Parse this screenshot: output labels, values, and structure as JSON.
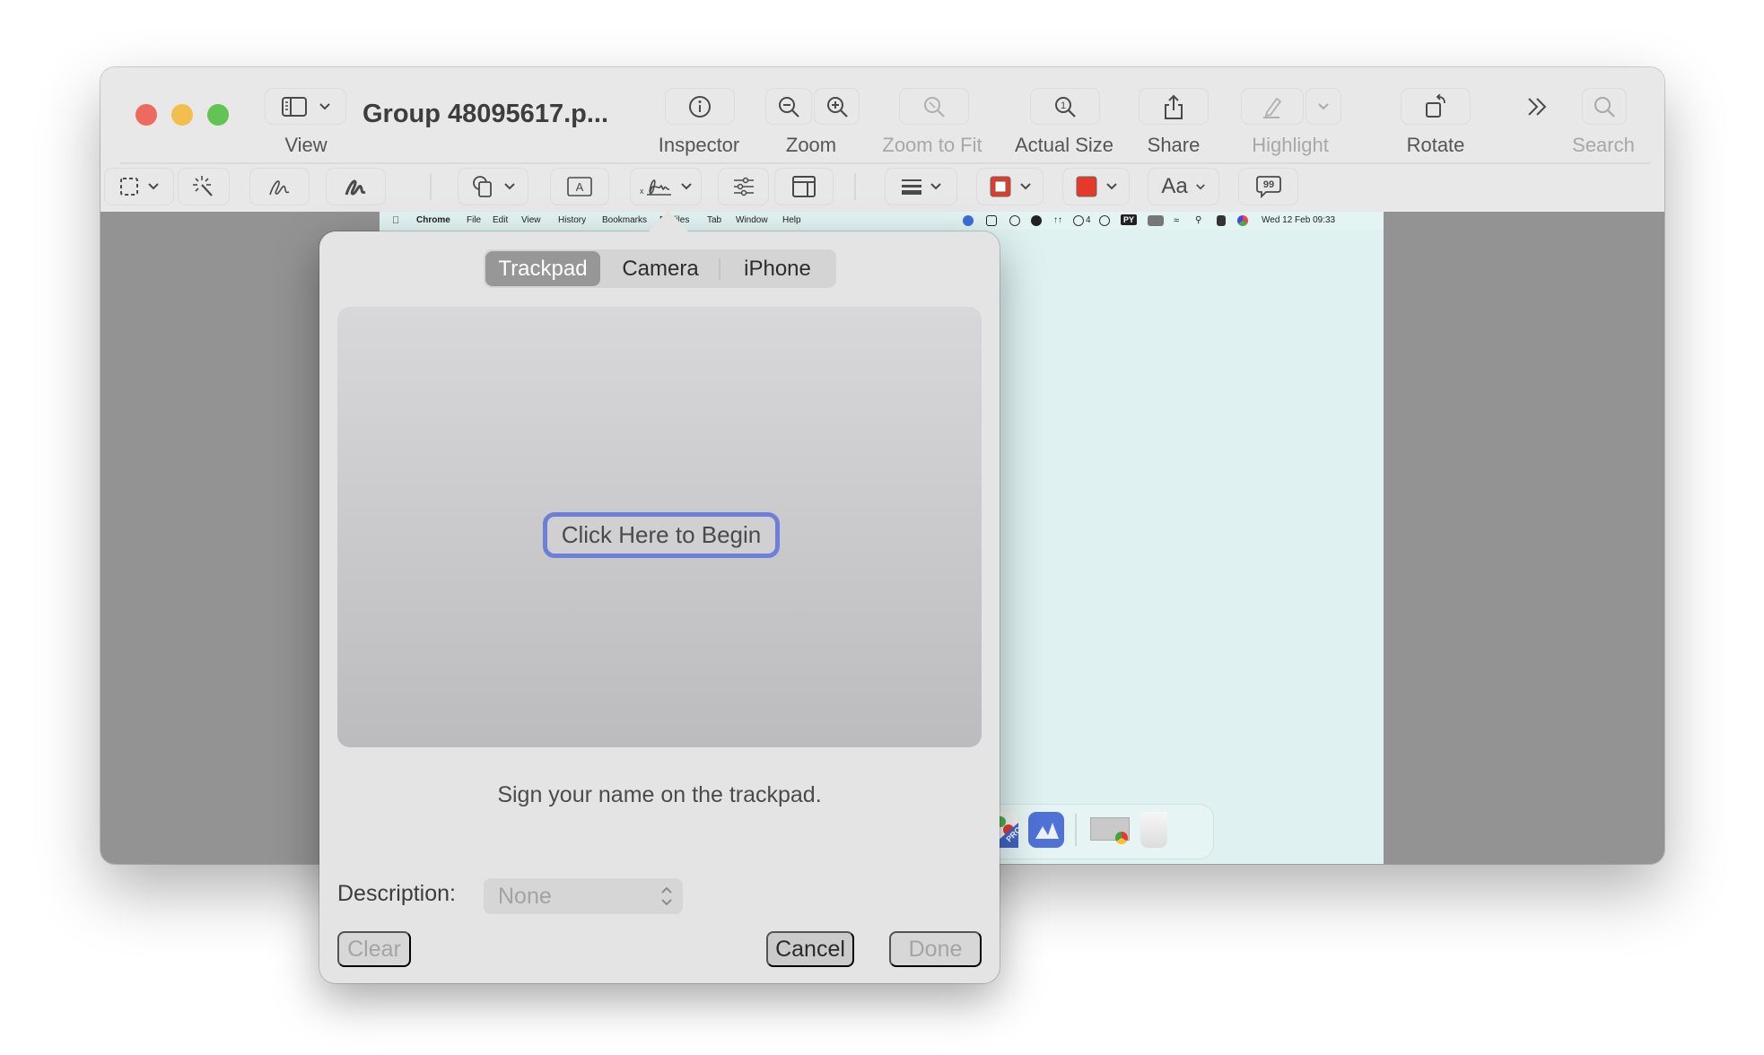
{
  "window": {
    "title": "Group 48095617.p...",
    "traffic_lights": {
      "close": "#ec6a5e",
      "minimize": "#f2bf4f",
      "zoom": "#61c454"
    }
  },
  "toolbar": {
    "view_label": "View",
    "inspector_label": "Inspector",
    "zoom_label": "Zoom",
    "zoom_to_fit_label": "Zoom to Fit",
    "actual_size_label": "Actual Size",
    "share_label": "Share",
    "highlight_label": "Highlight",
    "rotate_label": "Rotate",
    "search_label": "Search",
    "more_icon": "chevron-double-right-icon"
  },
  "markup_toolbar": {
    "tools": [
      "rectangular-selection",
      "instant-alpha",
      "sketch",
      "draw",
      "shapes",
      "text-box",
      "sign",
      "adjust-color",
      "page-layout",
      "line-style",
      "border-color",
      "fill-color",
      "text-style",
      "note"
    ],
    "border_color": "#e53a27",
    "fill_color": "#e53a27",
    "text_style_label": "Aa"
  },
  "document": {
    "page_color": "#dff2f1",
    "menubar": {
      "items": [
        "Chrome",
        "File",
        "Edit",
        "View",
        "History",
        "Bookmarks",
        "Profiles",
        "Tab",
        "Window",
        "Help"
      ],
      "status_badge_count": "4",
      "py_badge": "PY",
      "clock": "Wed 12 Feb  09:33"
    }
  },
  "signature_popover": {
    "tabs": [
      {
        "label": "Trackpad",
        "active": true
      },
      {
        "label": "Camera",
        "active": false
      },
      {
        "label": "iPhone",
        "active": false
      }
    ],
    "begin_button": "Click Here to Begin",
    "hint": "Sign your name on the trackpad.",
    "description_label": "Description:",
    "description_value": "None",
    "clear_label": "Clear",
    "cancel_label": "Cancel",
    "done_label": "Done",
    "focus_ring_color": "#6b80d6"
  }
}
